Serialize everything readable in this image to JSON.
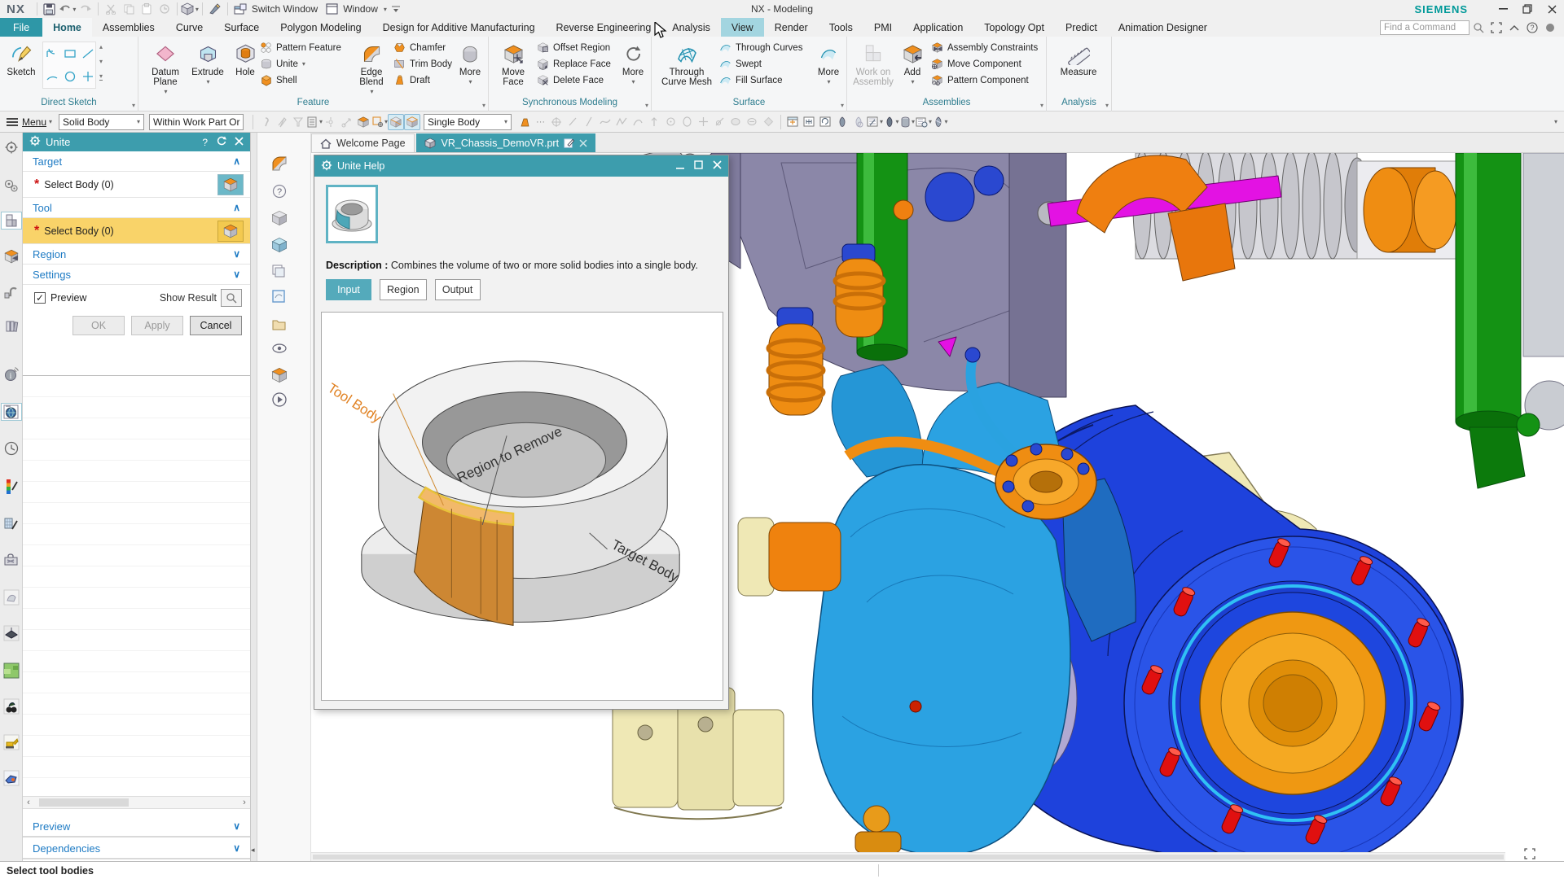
{
  "title_bar": {
    "logo": "NX",
    "app_title": "NX - Modeling",
    "brand": "SIEMENS",
    "switch_window": "Switch Window",
    "window_menu": "Window"
  },
  "find_command": {
    "placeholder": "Find a Command"
  },
  "ribbon_tabs": [
    {
      "label": "File"
    },
    {
      "label": "Home"
    },
    {
      "label": "Assemblies"
    },
    {
      "label": "Curve"
    },
    {
      "label": "Surface"
    },
    {
      "label": "Polygon Modeling"
    },
    {
      "label": "Design for Additive Manufacturing"
    },
    {
      "label": "Reverse Engineering"
    },
    {
      "label": "Analysis"
    },
    {
      "label": "View"
    },
    {
      "label": "Render"
    },
    {
      "label": "Tools"
    },
    {
      "label": "PMI"
    },
    {
      "label": "Application"
    },
    {
      "label": "Topology Opt"
    },
    {
      "label": "Predict"
    },
    {
      "label": "Animation Designer"
    }
  ],
  "ribbon": {
    "direct_sketch": {
      "label": "Direct Sketch",
      "sketch": "Sketch"
    },
    "feature": {
      "label": "Feature",
      "datum_plane": "Datum Plane",
      "extrude": "Extrude",
      "hole": "Hole",
      "pattern_feature": "Pattern Feature",
      "unite": "Unite",
      "shell": "Shell",
      "edge_blend": "Edge Blend",
      "chamfer": "Chamfer",
      "trim_body": "Trim Body",
      "draft": "Draft",
      "more": "More"
    },
    "synchronous": {
      "label": "Synchronous Modeling",
      "move_face": "Move Face",
      "offset_region": "Offset Region",
      "replace_face": "Replace Face",
      "delete_face": "Delete Face",
      "more": "More"
    },
    "surface": {
      "label": "Surface",
      "through_curve_mesh": "Through Curve Mesh",
      "through_curves": "Through Curves",
      "swept": "Swept",
      "fill_surface": "Fill Surface",
      "more": "More"
    },
    "assemblies": {
      "label": "Assemblies",
      "work_on_assembly": "Work on Assembly",
      "add": "Add",
      "assembly_constraints": "Assembly Constraints",
      "move_component": "Move Component",
      "pattern_component": "Pattern Component"
    },
    "analysis": {
      "label": "Analysis",
      "measure": "Measure"
    }
  },
  "toolbar": {
    "menu": "Menu",
    "type_filter": "Solid Body",
    "scope_filter": "Within Work Part Or",
    "selection_scope": "Single Body"
  },
  "doc_tabs": [
    {
      "label": "Welcome Page"
    },
    {
      "label": "VR_Chassis_DemoVR.prt"
    }
  ],
  "unite_dialog": {
    "title": "Unite",
    "target": "Target",
    "tool": "Tool",
    "select_body": "Select Body (0)",
    "region": "Region",
    "settings": "Settings",
    "preview": "Preview",
    "show_result": "Show Result",
    "ok": "OK",
    "apply": "Apply",
    "cancel": "Cancel"
  },
  "left_panel": {
    "preview": "Preview",
    "dependencies": "Dependencies"
  },
  "unite_help": {
    "title": "Unite Help",
    "description_label": "Description :",
    "description": "Combines the volume of two or more solid bodies into a single body.",
    "tabs": [
      {
        "label": "Input"
      },
      {
        "label": "Region"
      },
      {
        "label": "Output"
      }
    ],
    "illustration": {
      "tool_body": "Tool Body",
      "region_to_remove": "Region to Remove",
      "target_body": "Target Body"
    }
  },
  "status_bar": {
    "message": "Select tool bodies"
  },
  "colors": {
    "accent_teal": "#3d9dad",
    "selection_yellow": "#f9d369",
    "drum_blue": "#1e42dc",
    "hub_orange": "#ef9812",
    "stud_red": "#e01010",
    "knuckle_cyan": "#2ba2e2",
    "frame_cream": "#f0e9b6",
    "chassis_slate": "#8b87a8",
    "cylinder_green": "#149214",
    "rod_magenta": "#e312e3"
  }
}
